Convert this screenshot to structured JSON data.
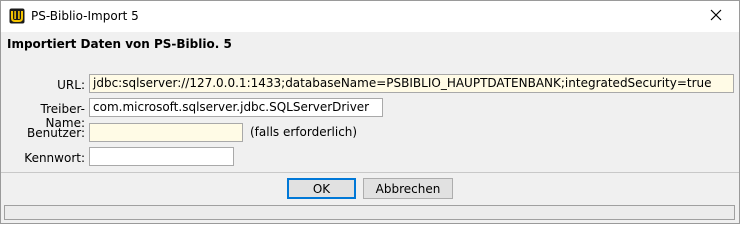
{
  "window": {
    "title": "PS-Biblio-Import 5",
    "icon": "ps-biblio-app-icon",
    "close_icon": "close-icon"
  },
  "form": {
    "heading": "Importiert Daten von PS-Biblio. 5",
    "url_label": "URL:",
    "url_value": "jdbc:sqlserver://127.0.0.1:1433;databaseName=PSBIBLIO_HAUPTDATENBANK;integratedSecurity=true",
    "driver_label": "Treiber-Name:",
    "driver_value": "com.microsoft.sqlserver.jdbc.SQLServerDriver",
    "user_label": "Benutzer:",
    "user_value": "",
    "user_hint": "(falls erforderlich)",
    "password_label": "Kennwort:",
    "password_value": ""
  },
  "buttons": {
    "ok_label": "OK",
    "cancel_label": "Abbrechen"
  },
  "status": {
    "text": ""
  }
}
